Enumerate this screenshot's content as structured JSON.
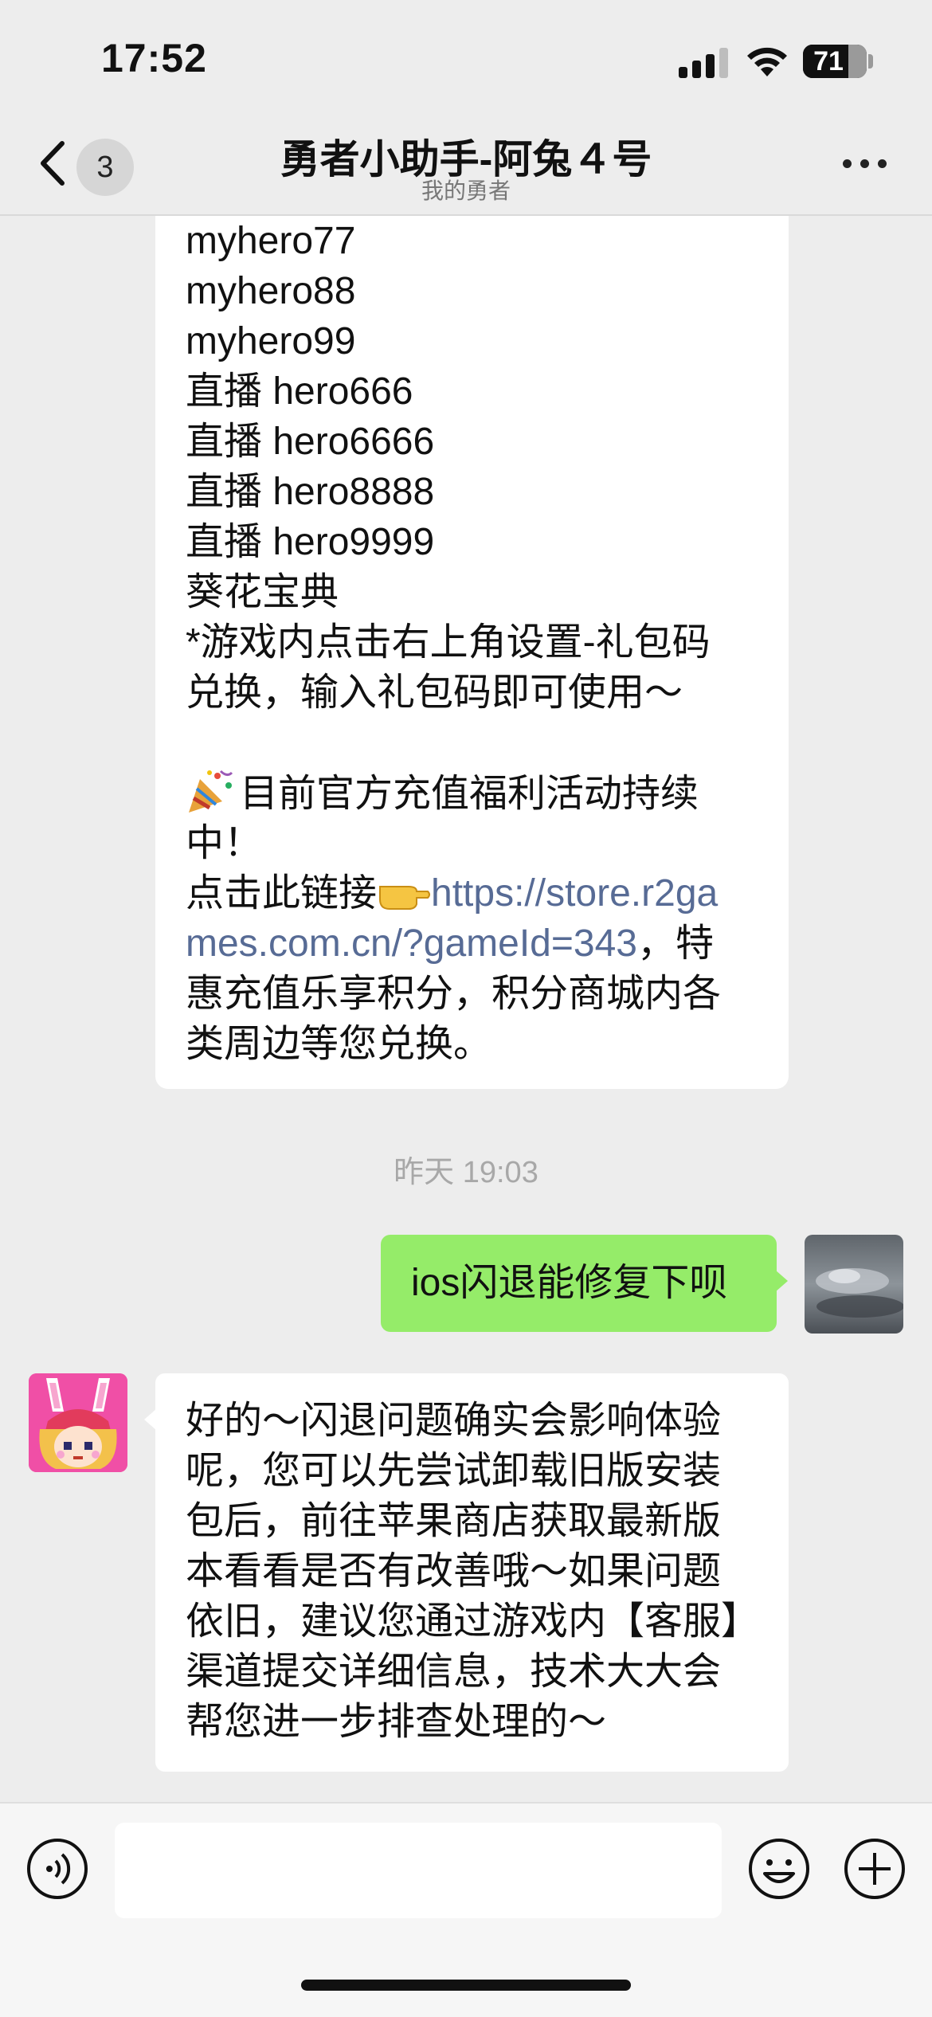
{
  "status_bar": {
    "time": "17:52",
    "battery_level": "71",
    "signal_icon": "cellular-signal-icon",
    "wifi_icon": "wifi-icon"
  },
  "nav": {
    "back_icon": "chevron-left-icon",
    "unread_count": "3",
    "title": "勇者小助手-阿兔４号",
    "subtitle": "我的勇者",
    "more_icon": "more-dots-icon"
  },
  "messages": {
    "top_incoming": {
      "lines": [
        "myhero77",
        "myhero88",
        "myhero99",
        "直播 hero666",
        "直播 hero6666",
        "直播 hero8888",
        "直播 hero9999",
        "葵花宝典",
        "*游戏内点击右上角设置-礼包码",
        "兑换，输入礼包码即可使用～",
        ""
      ],
      "promo_line_1": "目前官方充值福利活动持续",
      "promo_line_2": "中！",
      "link_prefix": "点击此链接",
      "link_part_1": "https://store.r2ga",
      "link_part_2": "mes.com.cn/?gameId=343",
      "link_suffix": "，特",
      "tail_lines": [
        "惠充值乐享积分，积分商城内各",
        "类周边等您兑换。"
      ],
      "party_emoji": "party-popper-icon",
      "point_emoji": "pointing-hand-icon"
    },
    "timestamp": "昨天 19:03",
    "outgoing": {
      "text": "ios闪退能修复下呗",
      "avatar": "user-avatar-cloudy-sky"
    },
    "reply": {
      "avatar": "bunny-girl-avatar",
      "lines": [
        "好的～闪退问题确实会影响体验",
        "呢，您可以先尝试卸载旧版安装",
        "包后，前往苹果商店获取最新版",
        "本看看是否有改善哦～如果问题",
        "依旧，建议您通过游戏内【客服】",
        "渠道提交详细信息，技术大大会",
        "帮您进一步排查处理的～"
      ]
    }
  },
  "input_bar": {
    "voice_icon": "voice-input-icon",
    "input_value": "",
    "emoji_icon": "emoji-face-icon",
    "plus_icon": "plus-circle-icon"
  },
  "colors": {
    "background": "#ededed",
    "outgoing_bubble": "#95ec69",
    "incoming_bubble": "#ffffff",
    "link": "#576b95"
  }
}
